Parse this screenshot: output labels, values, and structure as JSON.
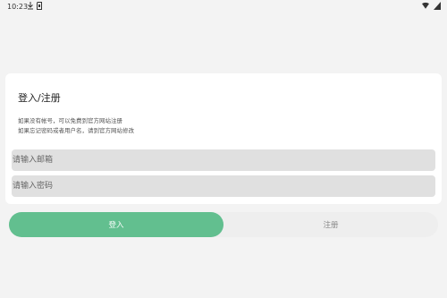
{
  "status_bar": {
    "time": "10:23",
    "icons": [
      "download-icon",
      "sd-card-icon",
      "wifi-icon",
      "battery-icon"
    ]
  },
  "card": {
    "title": "登入/注册",
    "desc_line1": "如果没有帐号，可以免费到官方网站注册",
    "desc_line2": "如果忘记密码或者用户名，请到官方网站修改"
  },
  "form": {
    "email_placeholder": "请输入邮箱",
    "password_placeholder": "请输入密码"
  },
  "buttons": {
    "login_label": "登入",
    "register_label": "注册"
  },
  "colors": {
    "accent": "#62bf8f",
    "background": "#f3f3f3",
    "input_bg": "#e0e0e0"
  }
}
